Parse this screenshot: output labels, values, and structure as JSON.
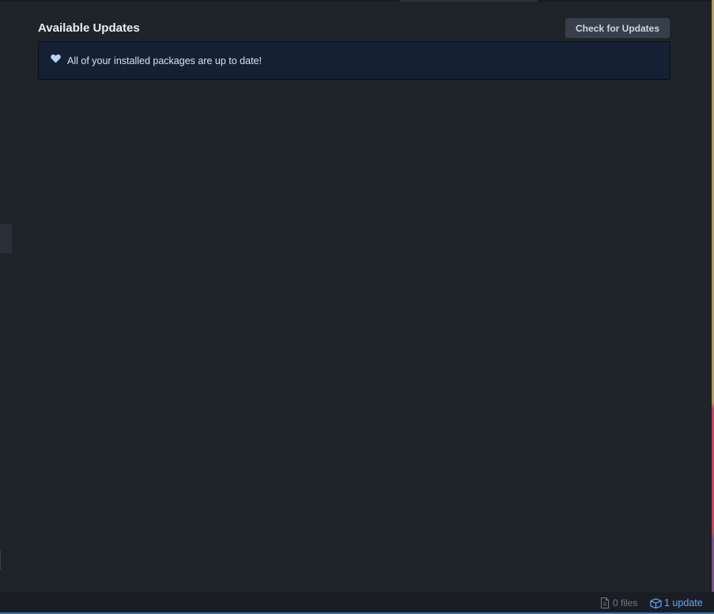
{
  "header": {
    "title": "Available Updates",
    "check_button_label": "Check for Updates"
  },
  "info": {
    "icon": "heart-icon",
    "message": "All of your installed packages are up to date!"
  },
  "status_bar": {
    "files_label": "0 files",
    "files_icon": "file-icon",
    "update_label": "1 update",
    "update_icon": "package-icon"
  },
  "colors": {
    "background": "#1f242b",
    "info_background": "#152033",
    "accent_blue": "#5aa8ff",
    "button_bg": "#37404a"
  }
}
